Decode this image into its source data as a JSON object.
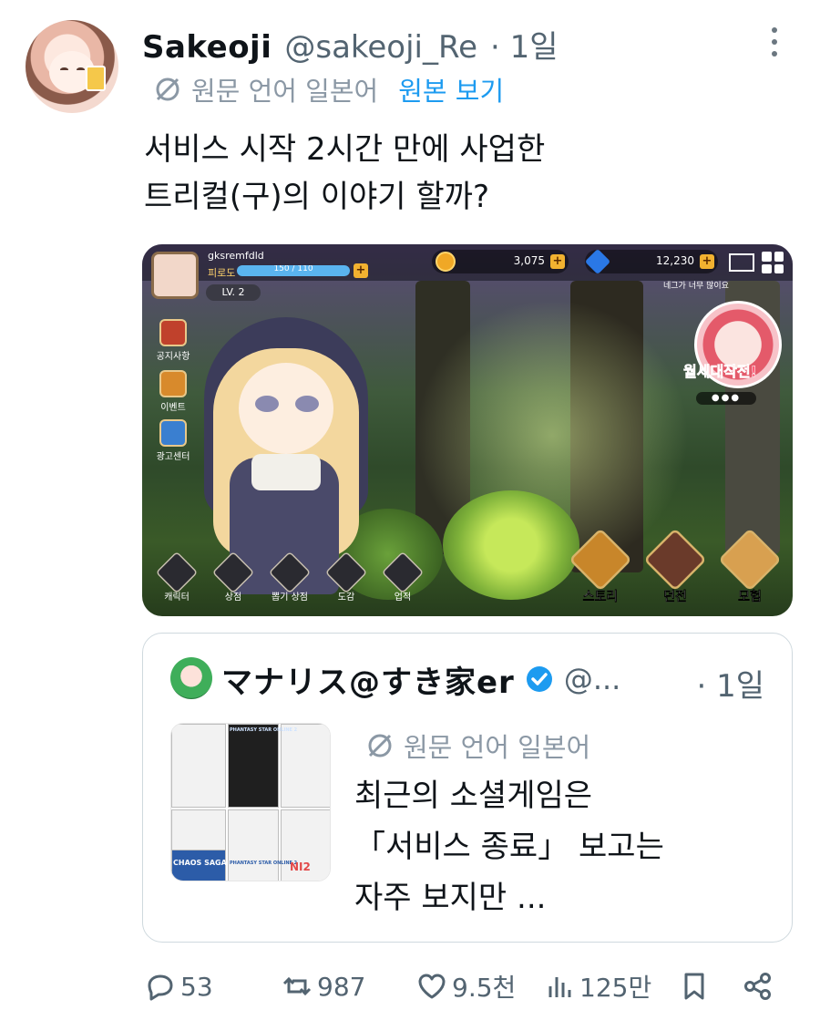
{
  "tweet": {
    "display_name": "Sakeoji",
    "handle": "@sakeoji_Re",
    "time": "· 1일",
    "translate_label": "원문 언어 일본어",
    "translate_link": "원본 보기",
    "text_line1": "서비스 시작 2시간 만에 사업한",
    "text_line2": "트리컬(구)의 이야기 할까?"
  },
  "game_screenshot": {
    "username": "gksremfdld",
    "fatigue_label": "피로도",
    "fatigue_value": "150 / 110",
    "fatigue_ratio": 1.0,
    "level": "LV. 2",
    "gold": "3,075",
    "gems": "12,230",
    "nickname_warning": "네그가 너무 많이요",
    "event_text": "월세대작전!",
    "side_menu": [
      "공지사항",
      "이벤트",
      "광고센터"
    ],
    "bottom_menu": [
      "캐릭터",
      "상점",
      "뽑기 상점",
      "도감",
      "업적"
    ],
    "big_menu": [
      "스토리",
      "던전",
      "모험"
    ],
    "pager_dots": "●●●"
  },
  "quote": {
    "display_name": "マナリス@すき家er",
    "handle": "@...",
    "time": "· 1일",
    "translate_label": "원문 언어 일본어",
    "text_line1": "최근의 소셜게임은",
    "text_line2": "「서비스 종료」 보고는",
    "text_line3": "자주 보지만  ...",
    "thumb_logos": [
      "CHAOS SAGA",
      "PHANTASY STAR ONLINE 2",
      "PHANTASY STAR ONLINE 2",
      "NI2"
    ]
  },
  "actions": {
    "replies": "53",
    "retweets": "987",
    "likes": "9.5천",
    "views": "125만"
  },
  "colors": {
    "link": "#1d9bf0",
    "secondary_text": "#536471",
    "translate_gray": "#8b98a5"
  }
}
